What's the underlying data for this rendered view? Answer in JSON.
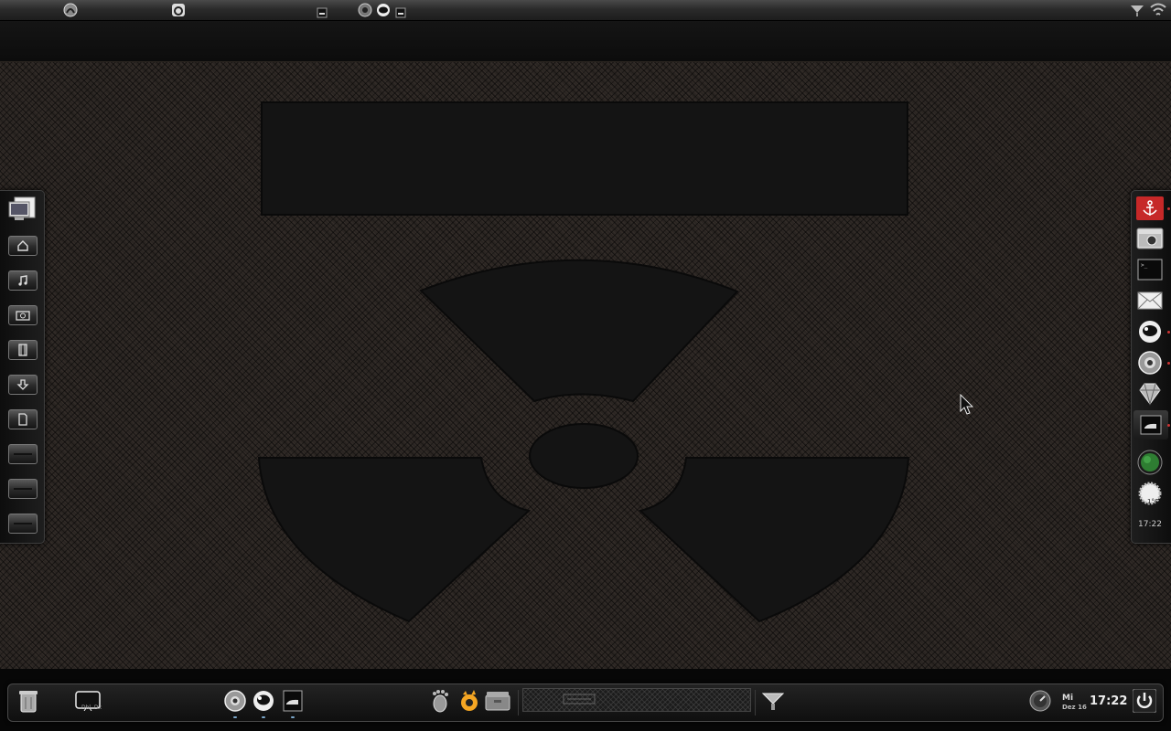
{
  "top_panel": {
    "icons": [
      "gnome-foot-icon",
      "gimp-icon",
      "minimized-window-icon",
      "gear-app-icon",
      "astronaut-app-icon",
      "window-icon"
    ],
    "tray_icons": [
      "network-icon",
      "wifi-icon"
    ]
  },
  "left_dock": {
    "items": [
      "computer-icon",
      "home-folder-icon",
      "music-folder-icon",
      "pictures-folder-icon",
      "videos-folder-icon",
      "downloads-folder-icon",
      "documents-folder-icon",
      "drive-icon",
      "drive-icon",
      "drive-icon"
    ]
  },
  "right_dock": {
    "items": [
      "anchor-icon",
      "camera-icon",
      "terminal-icon",
      "mail-icon",
      "astronaut-app-icon",
      "gear-app-icon",
      "gem-icon",
      "window-icon",
      "green-globe-icon",
      "weather-icon"
    ],
    "weather_temp": "1°C",
    "clock": "17:22"
  },
  "bottom_dock": {
    "left_items": [
      "trash-icon",
      "desktop-display-icon"
    ],
    "desktop_label": "Dbl. Dx",
    "running_items": [
      "gear-app-icon",
      "astronaut-app-icon",
      "window-icon"
    ],
    "launchers": [
      "gnome-foot-icon",
      "gimp-icon",
      "archive-icon"
    ],
    "network_icon": "network-icon",
    "volume_icon": "volume-knob-icon",
    "day": "Mi",
    "date": "Dez 16",
    "time": "17:22",
    "power_icon": "power-icon"
  },
  "colors": {
    "desktop_bg": "#2a2522",
    "shape_fill": "#141414",
    "accent_red": "#c62828",
    "indicator_blue": "#7aa6c9"
  }
}
